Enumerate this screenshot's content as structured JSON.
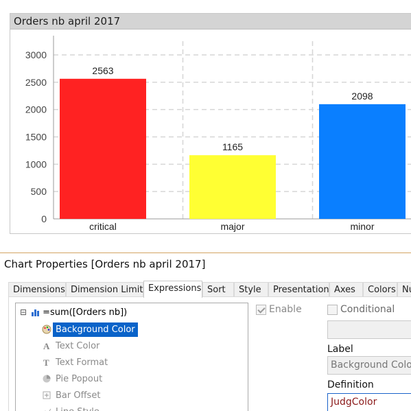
{
  "chart": {
    "caption": "Orders nb april 2017"
  },
  "chart_data": {
    "type": "bar",
    "title": "Orders nb april 2017",
    "categories": [
      "critical",
      "major",
      "minor"
    ],
    "values": [
      2563,
      1165,
      2098
    ],
    "colors": [
      "#ff2222",
      "#ffff33",
      "#0a7fff"
    ],
    "yticks": [
      0,
      500,
      1000,
      1500,
      2000,
      2500,
      3000
    ],
    "ylim": [
      0,
      3000
    ],
    "grid": true,
    "xlabel": "",
    "ylabel": ""
  },
  "dialog": {
    "title": "Chart Properties [Orders nb april 2017]",
    "tabs": [
      "Dimensions",
      "Dimension Limits",
      "Expressions",
      "Sort",
      "Style",
      "Presentation",
      "Axes",
      "Colors",
      "Nu"
    ],
    "active_tab": "Expressions"
  },
  "tree": {
    "expand_glyph": "⊟",
    "expression": "=sum([Orders nb])",
    "items": [
      {
        "label": "Background Color",
        "icon": "palette-icon",
        "selected": true,
        "enabled": true
      },
      {
        "label": "Text Color",
        "icon": "text-color-icon",
        "selected": false,
        "enabled": false
      },
      {
        "label": "Text Format",
        "icon": "text-format-icon",
        "selected": false,
        "enabled": false
      },
      {
        "label": "Pie Popout",
        "icon": "pie-icon",
        "selected": false,
        "enabled": false
      },
      {
        "label": "Bar Offset",
        "icon": "bar-offset-icon",
        "selected": false,
        "enabled": false
      },
      {
        "label": "Line Style",
        "icon": "line-style-icon",
        "selected": false,
        "enabled": false
      }
    ]
  },
  "props": {
    "enable_label": "Enable",
    "enable_checked": true,
    "conditional_label": "Conditional",
    "conditional_checked": false,
    "label_caption": "Label",
    "label_value": "Background Color",
    "definition_caption": "Definition",
    "definition_value": "JudgColor"
  }
}
